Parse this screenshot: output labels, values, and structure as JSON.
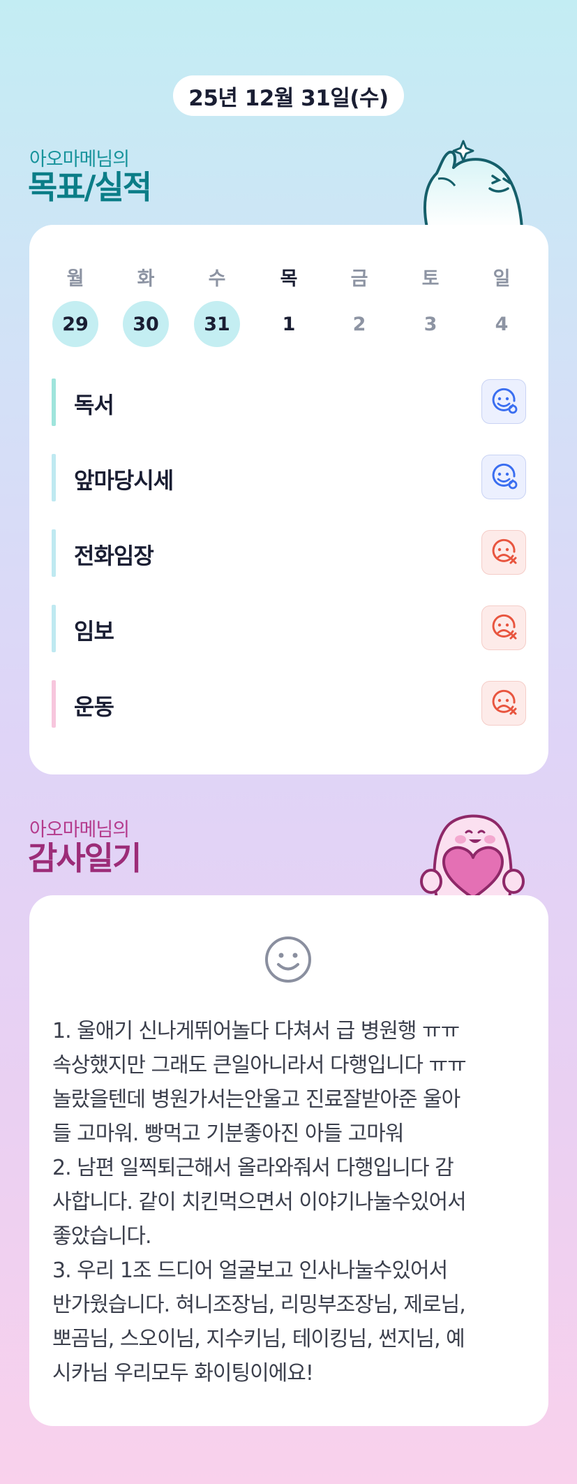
{
  "date": "25년 12월 31일(수)",
  "goals_section": {
    "owner": "아오마메님의",
    "title": "목표/실적",
    "days": [
      {
        "label": "월",
        "num": "29",
        "state": "done"
      },
      {
        "label": "화",
        "num": "30",
        "state": "done"
      },
      {
        "label": "수",
        "num": "31",
        "state": "done"
      },
      {
        "label": "목",
        "num": "1",
        "state": "today"
      },
      {
        "label": "금",
        "num": "2",
        "state": "future"
      },
      {
        "label": "토",
        "num": "3",
        "state": "future"
      },
      {
        "label": "일",
        "num": "4",
        "state": "future"
      }
    ],
    "goals": [
      {
        "label": "독서",
        "status": "success",
        "bar_color": "#9fe4dc"
      },
      {
        "label": "앞마당시세",
        "status": "success",
        "bar_color": "#bfe9f1"
      },
      {
        "label": "전화임장",
        "status": "fail",
        "bar_color": "#bfe9f1"
      },
      {
        "label": "임보",
        "status": "fail",
        "bar_color": "#bfe9f1"
      },
      {
        "label": "운동",
        "status": "fail",
        "bar_color": "#f7c6dd"
      }
    ]
  },
  "gratitude_section": {
    "owner": "아오마메님의",
    "title": "감사일기",
    "mood_icon": "smile-icon",
    "text": "1. 울애기 신나게뛰어놀다 다쳐서 급 병원행 ㅠㅠ\n속상했지만 그래도 큰일아니라서 다행입니다 ㅠㅠ\n놀랐을텐데 병원가서는안울고 진료잘받아준 울아\n들 고마워. 빵먹고 기분좋아진 아들 고마워\n2. 남편 일찍퇴근해서 올라와줘서 다행입니다 감\n사합니다. 같이 치킨먹으면서 이야기나눌수있어서\n좋았습니다.\n3. 우리 1조 드디어 얼굴보고 인사나눌수있어서\n반가웠습니다. 혀니조장님, 리밍부조장님, 제로님,\n뽀곰님, 스오이님, 지수키님, 테이킹님, 썬지님, 예\n시카님 우리모두 화이팅이에요!"
  },
  "colors": {
    "success": "#3a6ef0",
    "fail": "#e8553f",
    "teal_title": "#0b7d87",
    "pink_title": "#9c2c78",
    "done_day_bg": "#c4eef2"
  },
  "icons": {
    "success": "happy-face-icon",
    "fail": "sad-face-x-icon",
    "mascot_top": "thumbs-up-mascot",
    "mascot_bottom": "heart-mascot"
  }
}
